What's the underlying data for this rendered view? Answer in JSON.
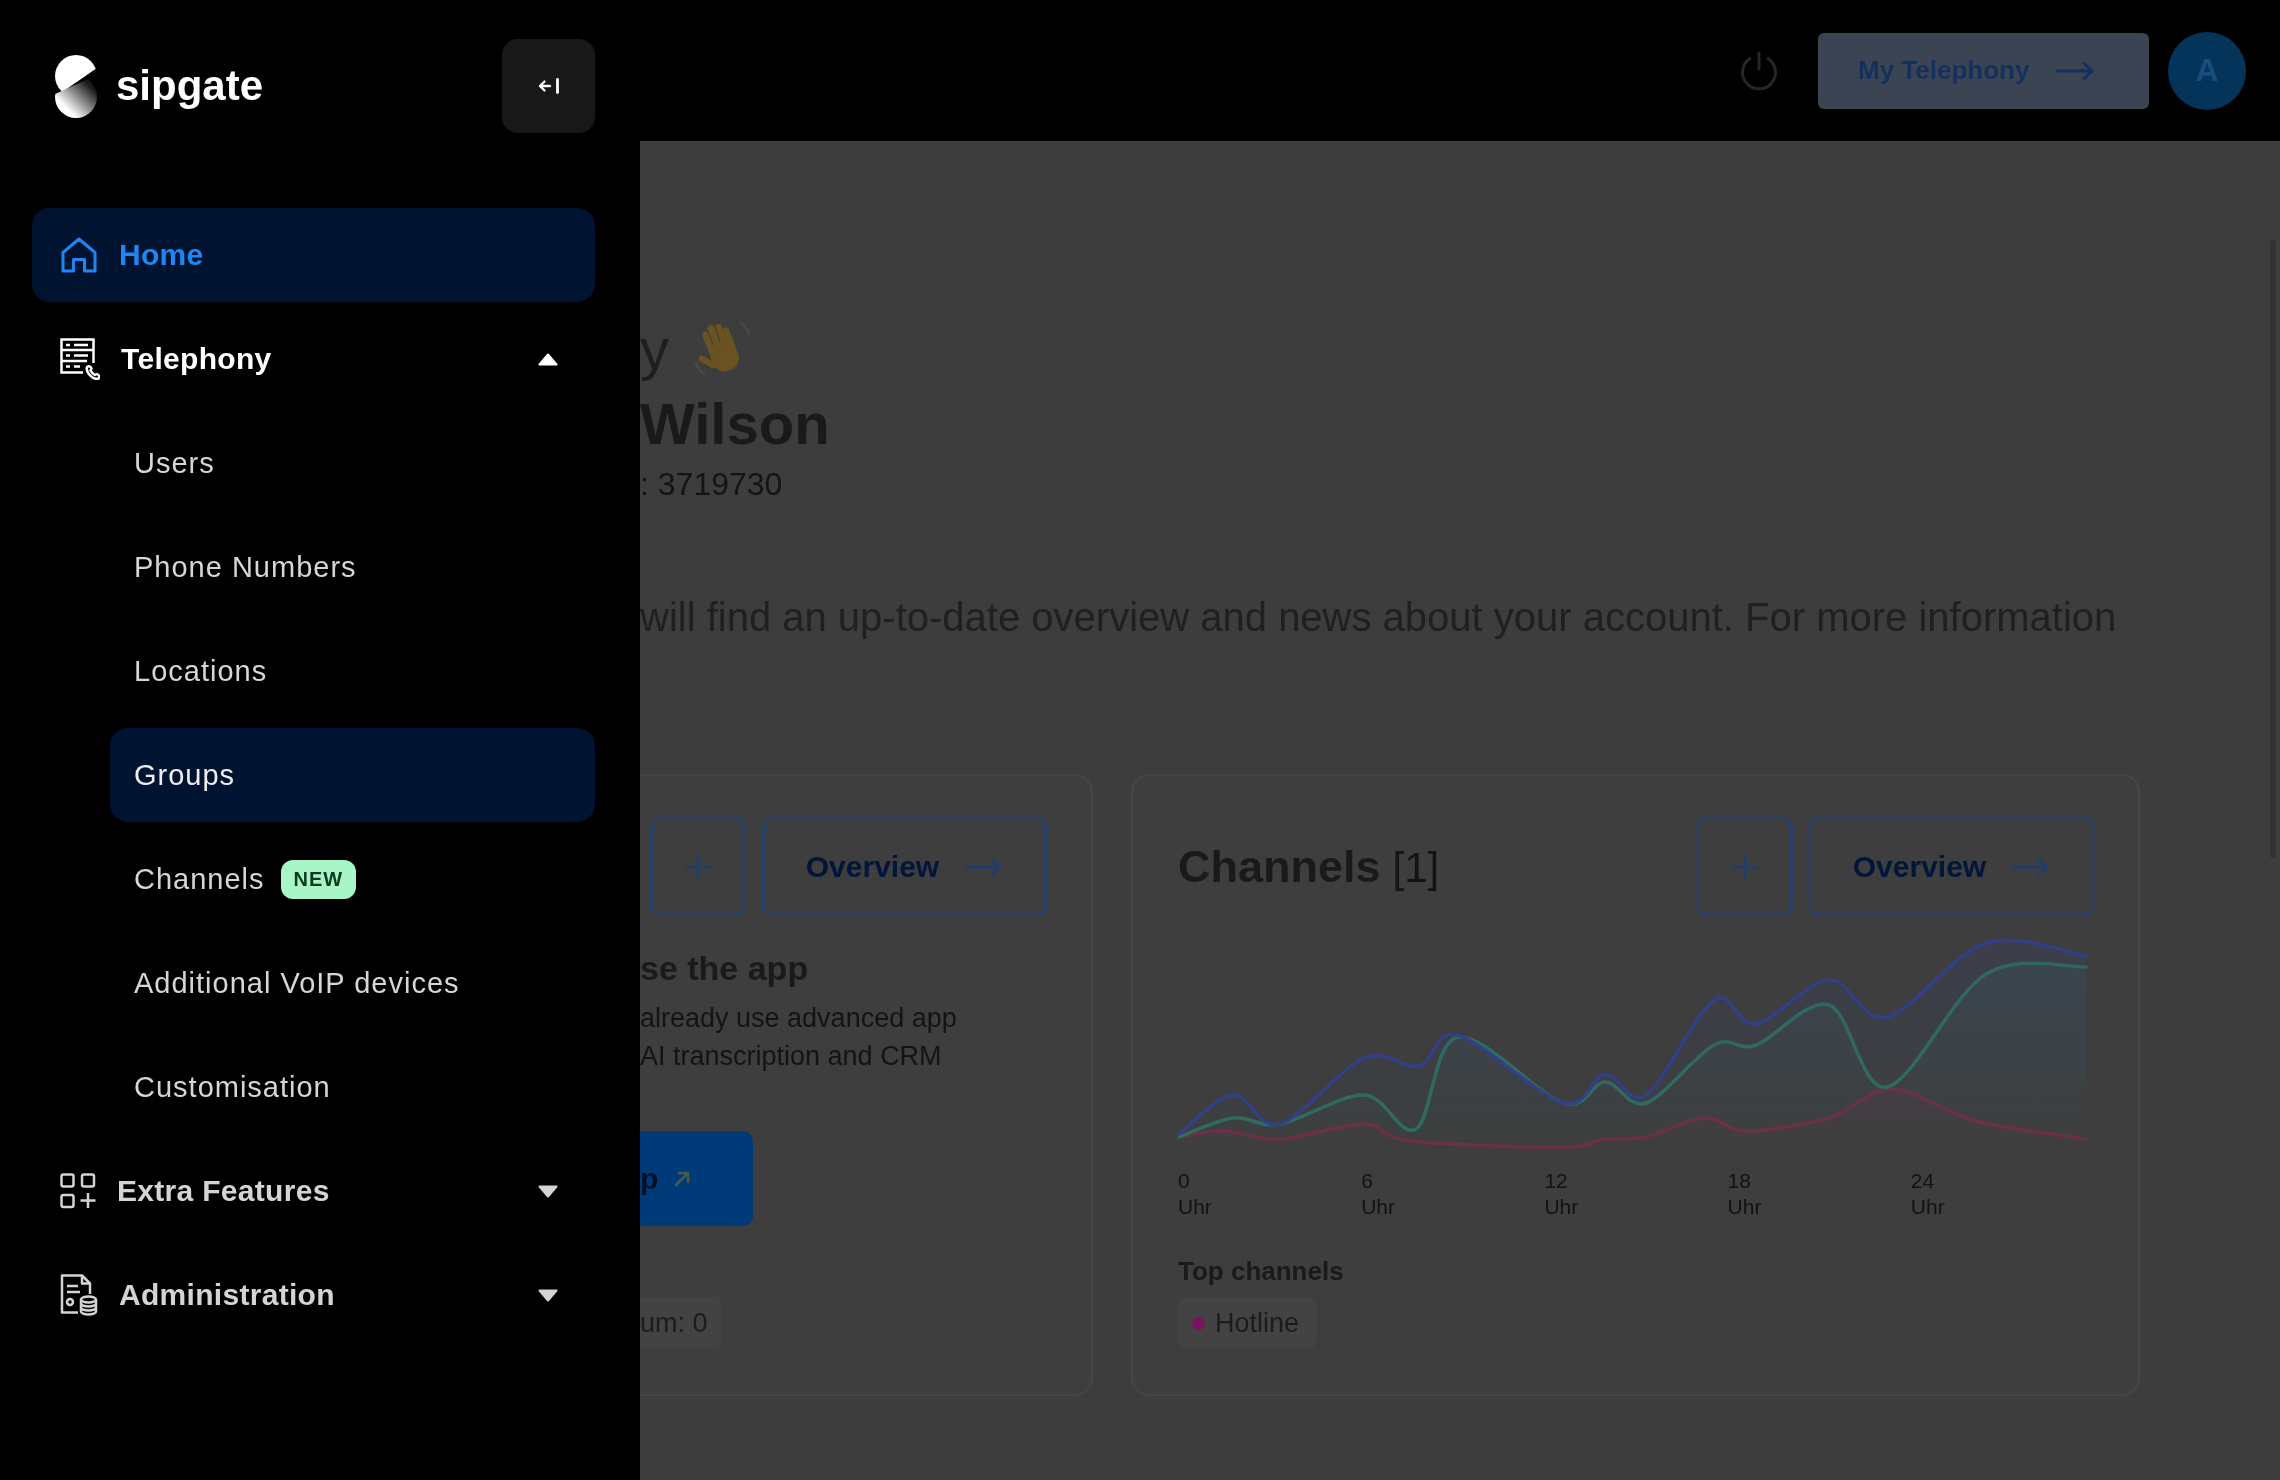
{
  "sidebar": {
    "brand": "sipgate",
    "items": [
      {
        "kind": "link",
        "label": "Home",
        "selected": true
      },
      {
        "kind": "group",
        "label": "Telephony",
        "selected": false,
        "expanded": true,
        "children": [
          {
            "label": "Users",
            "selected": false
          },
          {
            "label": "Phone Numbers",
            "selected": false
          },
          {
            "label": "Locations",
            "selected": false
          },
          {
            "label": "Groups",
            "selected": true
          },
          {
            "label": "Channels",
            "selected": false,
            "badge": "NEW"
          },
          {
            "label": "Additional VoIP devices",
            "selected": false
          },
          {
            "label": "Customisation",
            "selected": false
          }
        ]
      },
      {
        "kind": "group",
        "label": "Extra Features",
        "selected": false,
        "expanded": false
      },
      {
        "kind": "group",
        "label": "Administration",
        "selected": false,
        "expanded": false
      }
    ]
  },
  "header": {
    "button": "My Telephony",
    "avatar": "A"
  },
  "page": {
    "greeting": "y",
    "name": "Wilson",
    "customer_number": ": 3719730",
    "intro": "will find an up-to-date overview and news about your account. For more information",
    "app_card": {
      "overview_button": "Overview",
      "title": "se the app",
      "lines": [
        "already use advanced app",
        "AI transcription and CRM"
      ],
      "button": "p",
      "chip": "um: 0"
    },
    "channels_card": {
      "title": "Channels",
      "count": "[1]",
      "overview_button": "Overview",
      "x_labels": [
        {
          "value": "0",
          "unit": "Uhr"
        },
        {
          "value": "6",
          "unit": "Uhr"
        },
        {
          "value": "12",
          "unit": "Uhr"
        },
        {
          "value": "18",
          "unit": "Uhr"
        },
        {
          "value": "24",
          "unit": "Uhr"
        }
      ],
      "top_channels_label": "Top channels",
      "top_channels": [
        {
          "name": "Hotline",
          "color": "#7a1462"
        }
      ]
    }
  }
}
